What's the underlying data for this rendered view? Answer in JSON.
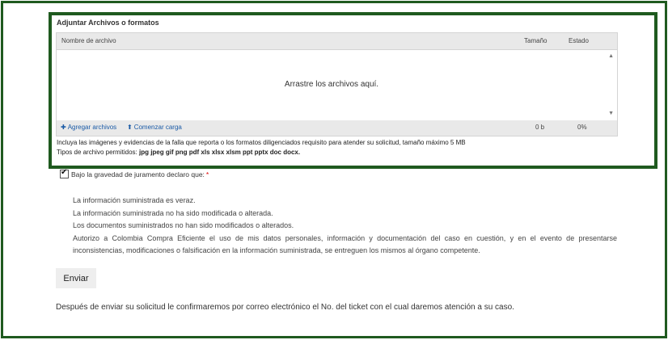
{
  "upload": {
    "title": "Adjuntar Archivos o formatos",
    "columns": {
      "name": "Nombre de archivo",
      "size": "Tamaño",
      "status": "Estado"
    },
    "drop_text": "Arrastre los archivos aquí.",
    "add_files": "Agregar archivos",
    "start_upload": "Comenzar carga",
    "total_size": "0 b",
    "total_percent": "0%",
    "scroll_up_icon": "triangle-up",
    "scroll_down_icon": "triangle-down",
    "add_icon": "plus",
    "upload_icon": "arrow-up"
  },
  "instructions": {
    "line1": "Incluya las imágenes y evidencias de la falla que reporta o los formatos diligenciados requisito para atender su solicitud, tamaño máximo 5 MB",
    "types_label": "Tipos de archivo permitidos: ",
    "types_list": "jpg jpeg gif png pdf xls xlsx xlsm ppt pptx doc docx."
  },
  "oath": {
    "label": "Bajo la gravedad de juramento declaro que:",
    "required_mark": "*",
    "checked": true
  },
  "statements": [
    "La información suministrada es veraz.",
    "La información suministrada no ha sido modificada o alterada.",
    "Los documentos suministrados no han sido modificados o alterados.",
    "Autorizo a Colombia Compra Eficiente el uso de mis datos personales, información y documentación del caso en cuestión, y en el evento de presentarse",
    "inconsistencias, modificaciones o falsificación en la información suministrada, se entreguen los mismos al órgano competente."
  ],
  "send_label": "Enviar",
  "after_text": "Después de enviar su solicitud le confirmaremos por correo electrónico el No. del ticket con el cual daremos atención a su caso.",
  "colors": {
    "frame": "#1f5a1f",
    "link": "#1a5aa6",
    "required": "#dd0000"
  }
}
